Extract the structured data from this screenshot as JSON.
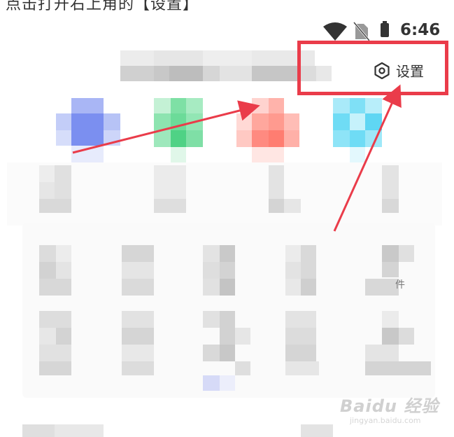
{
  "caption": "点击打开右上角的【设置】",
  "status_bar": {
    "time": "6:46",
    "icons": [
      "wifi-icon",
      "no-sim-icon",
      "battery-icon"
    ]
  },
  "settings": {
    "label": "设置",
    "icon": "gear-icon"
  },
  "cropped_side_label": "件",
  "watermark": {
    "brand": "Baidu 经验",
    "url": "jingyan.baidu.com"
  },
  "colors": {
    "highlight": "#ea3c4a",
    "arrow": "#ea3c4a",
    "app_blue": "#7b8ff0",
    "app_green": "#5fd88f",
    "app_red": "#ff8a80",
    "app_cyan": "#6fdcf5"
  }
}
